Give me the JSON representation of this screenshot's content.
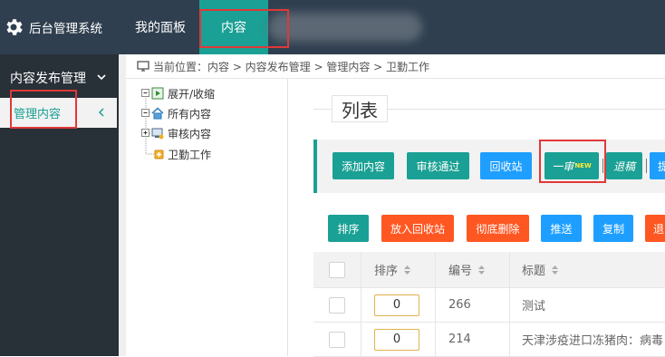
{
  "header": {
    "app_title": "后台管理系统",
    "nav": {
      "dashboard": "我的面板",
      "content": "内容"
    }
  },
  "sidebar": {
    "group_label": "内容发布管理",
    "active_item": "管理内容"
  },
  "breadcrumb": "当前位置：内容 > 内容发布管理 > 管理内容 > 卫勤工作",
  "tree": {
    "toggle": "展开/收缩",
    "all": "所有内容",
    "review": "审核内容",
    "weiqin": "卫勤工作"
  },
  "panel": {
    "legend": "列表"
  },
  "toolbar1": {
    "add": "添加内容",
    "approve": "审核通过",
    "recycle": "回收站",
    "first": "一审",
    "first_badge": "NEW",
    "return": "退稿",
    "more": "提"
  },
  "toolbar2": {
    "sort": "排序",
    "to_recycle": "放入回收站",
    "delete": "彻底删除",
    "push": "推送",
    "copy": "复制",
    "more": "退"
  },
  "table": {
    "headers": {
      "sort": "排序",
      "id": "编号",
      "title": "标题"
    },
    "rows": [
      {
        "order": "0",
        "id": "266",
        "title": "测试"
      },
      {
        "order": "0",
        "id": "214",
        "title": "天津涉疫进口冻猪肉：病毒"
      }
    ]
  },
  "colors": {
    "accent": "#1aa094",
    "topbar": "#2f3f4f",
    "sidebar": "#283038",
    "blue": "#1e9fff",
    "orange": "#ff5722",
    "highlight": "#e03838"
  }
}
